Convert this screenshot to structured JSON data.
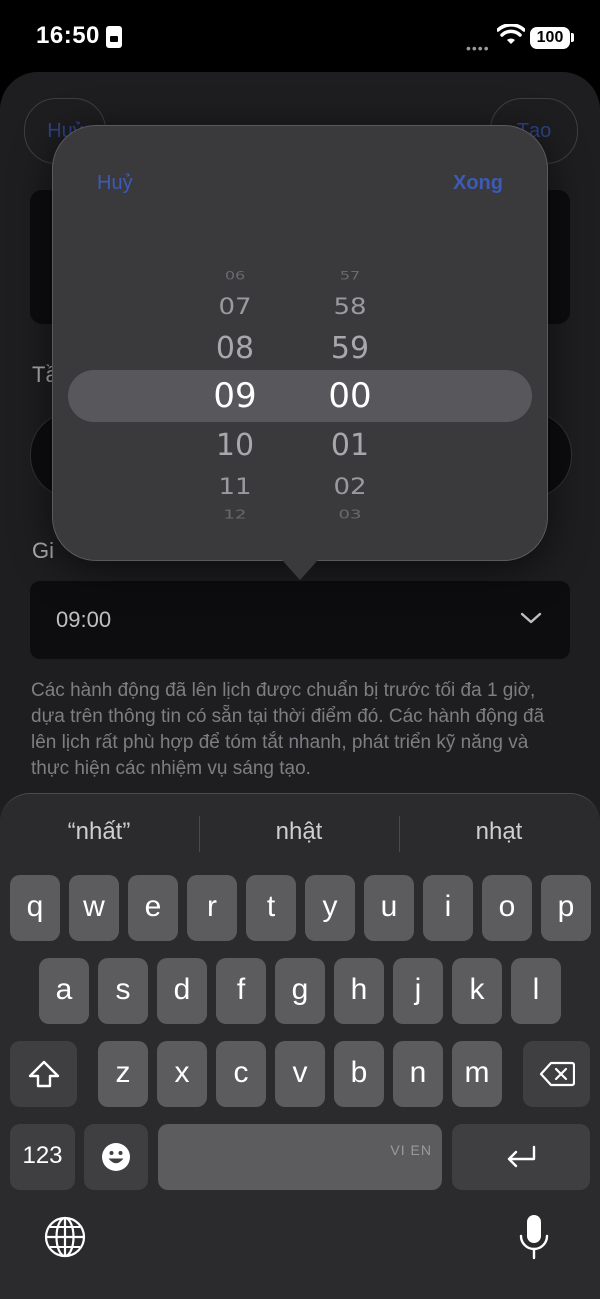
{
  "status_bar": {
    "time": "16:50",
    "battery": "100"
  },
  "header": {
    "cancel_label": "Huỷ",
    "create_label": "Tạo"
  },
  "form": {
    "frequency_label": "Tầ",
    "time_label": "Gi",
    "time_value": "09:00",
    "description": "Các hành động đã lên lịch được chuẩn bị trước tối đa 1 giờ, dựa trên thông tin có sẵn tại thời điểm đó. Các hành động đã lên lịch rất phù hợp để tóm tắt nhanh, phát triển kỹ năng và thực hiện các nhiệm vụ sáng tạo."
  },
  "time_picker": {
    "cancel_label": "Huỷ",
    "done_label": "Xong",
    "hours": [
      "06",
      "07",
      "08",
      "09",
      "10",
      "11",
      "12"
    ],
    "minutes": [
      "57",
      "58",
      "59",
      "00",
      "01",
      "02",
      "03"
    ],
    "selected_hour": "09",
    "selected_minute": "00"
  },
  "keyboard": {
    "suggestions": [
      "“nhất”",
      "nhật",
      "nhạt"
    ],
    "row1": [
      "q",
      "w",
      "e",
      "r",
      "t",
      "y",
      "u",
      "i",
      "o",
      "p"
    ],
    "row2": [
      "a",
      "s",
      "d",
      "f",
      "g",
      "h",
      "j",
      "k",
      "l"
    ],
    "row3": [
      "z",
      "x",
      "c",
      "v",
      "b",
      "n",
      "m"
    ],
    "numbers_key": "123",
    "space_label": "VI EN"
  }
}
